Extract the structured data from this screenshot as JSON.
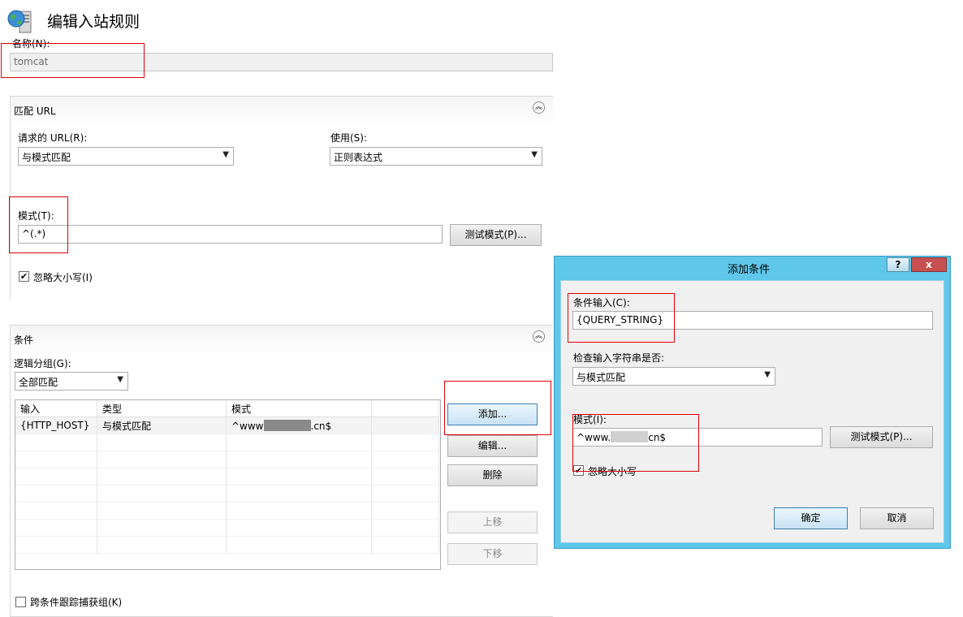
{
  "page": {
    "title": "编辑入站规则",
    "icon": "globe-server-icon",
    "name_label": "名称(N):",
    "name_value": "tomcat"
  },
  "match_url": {
    "section_title": "匹配 URL",
    "requested_url_label": "请求的 URL(R):",
    "requested_url_value": "与模式匹配",
    "using_label": "使用(S):",
    "using_value": "正则表达式",
    "pattern_label": "模式(T):",
    "pattern_value": "^(.*)",
    "test_pattern_button": "测试模式(P)...",
    "ignore_case_label": "忽略大小写(I)",
    "ignore_case_checked": true
  },
  "conditions": {
    "section_title": "条件",
    "logical_grouping_label": "逻辑分组(G):",
    "logical_grouping_value": "全部匹配",
    "columns": [
      "输入",
      "类型",
      "模式"
    ],
    "rows": [
      {
        "input": "{HTTP_HOST}",
        "type": "与模式匹配",
        "pattern_prefix": "^www",
        "pattern_suffix": ".cn$"
      }
    ],
    "buttons": {
      "add": "添加...",
      "edit": "编辑...",
      "remove": "删除",
      "move_up": "上移",
      "move_down": "下移"
    },
    "track_captures_label": "跨条件跟踪捕获组(K)",
    "track_captures_checked": false
  },
  "dialog": {
    "title": "添加条件",
    "help_button": "?",
    "close_button": "x",
    "condition_input_label": "条件输入(C):",
    "condition_input_value": "{QUERY_STRING}",
    "check_if_label": "检查输入字符串是否:",
    "check_if_value": "与模式匹配",
    "pattern_label": "模式(I):",
    "pattern_prefix": "^www.",
    "pattern_suffix": "cn$",
    "test_pattern_button": "测试模式(P)...",
    "ignore_case_label": "忽略大小写",
    "ignore_case_checked": true,
    "ok_button": "确定",
    "cancel_button": "取消"
  },
  "colors": {
    "dialog_frame": "#5ec7ea",
    "close_button": "#c75050",
    "highlight_box": "#e0000a"
  }
}
